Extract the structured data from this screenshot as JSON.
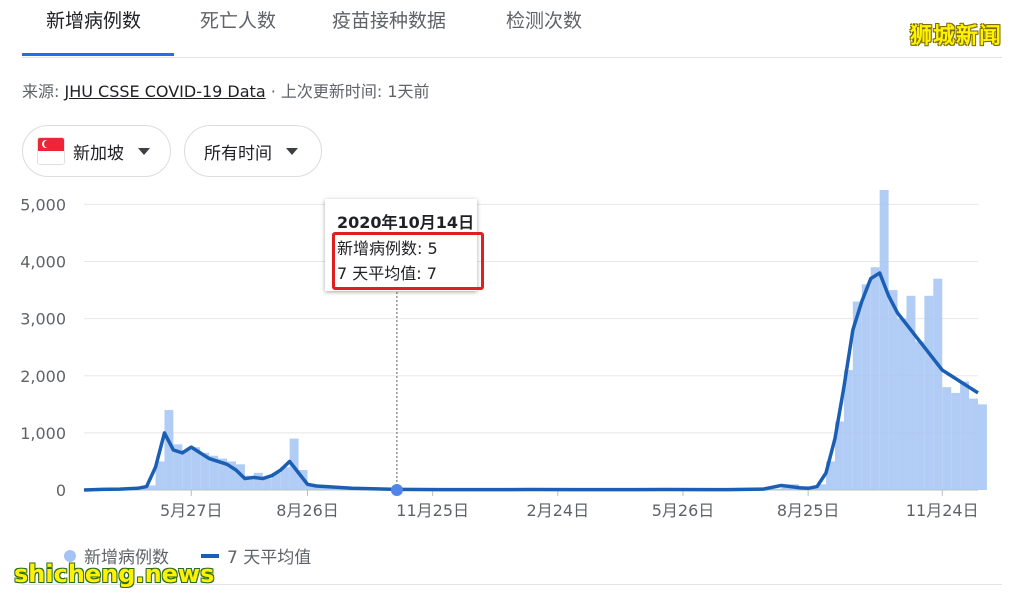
{
  "tabs": [
    {
      "label": "新增病例数",
      "active": true
    },
    {
      "label": "死亡人数",
      "active": false
    },
    {
      "label": "疫苗接种数据",
      "active": false
    },
    {
      "label": "检测次数",
      "active": false
    }
  ],
  "watermark_top": "狮城新闻",
  "source": {
    "prefix": "来源:",
    "link": "JHU CSSE COVID-19 Data",
    "suffix": "· 上次更新时间: 1天前"
  },
  "filters": {
    "country": "新加坡",
    "time_range": "所有时间"
  },
  "tooltip": {
    "date": "2020年10月14日",
    "line1": "新增病例数: 5",
    "line2": "7 天平均值: 7"
  },
  "legend": {
    "bars": "新增病例数",
    "line": "7 天平均值"
  },
  "watermark_bottom": "shicheng.news",
  "colors": {
    "bar": "#a5c4f3",
    "line": "#1a5fb4",
    "accent": "#1a73e8",
    "highlight": "#e02020"
  },
  "chart_data": {
    "type": "bar",
    "title": "",
    "xlabel": "",
    "ylabel": "",
    "ylim": [
      0,
      5000
    ],
    "yticks": [
      "0",
      "1,000",
      "2,000",
      "3,000",
      "4,000",
      "5,000"
    ],
    "xticks": [
      "5月27日",
      "8月26日",
      "11月25日",
      "2月24日",
      "5月26日",
      "8月25日",
      "11月24日"
    ],
    "tick_positions": [
      0.12,
      0.25,
      0.39,
      0.53,
      0.67,
      0.81,
      0.96
    ],
    "highlight_x": 0.35,
    "series": [
      {
        "name": "新增病例数",
        "kind": "bar",
        "x": [
          0.0,
          0.02,
          0.04,
          0.06,
          0.07,
          0.08,
          0.09,
          0.1,
          0.11,
          0.12,
          0.13,
          0.14,
          0.15,
          0.16,
          0.17,
          0.18,
          0.19,
          0.2,
          0.21,
          0.22,
          0.23,
          0.24,
          0.25,
          0.26,
          0.28,
          0.3,
          0.35,
          0.4,
          0.45,
          0.5,
          0.55,
          0.6,
          0.65,
          0.7,
          0.72,
          0.76,
          0.78,
          0.8,
          0.81,
          0.82,
          0.83,
          0.84,
          0.85,
          0.86,
          0.87,
          0.88,
          0.89,
          0.9,
          0.91,
          0.92,
          0.93,
          0.94,
          0.95,
          0.96,
          0.97,
          0.98,
          0.99,
          1.0
        ],
        "values": [
          0,
          10,
          20,
          40,
          80,
          500,
          1400,
          800,
          700,
          750,
          650,
          600,
          550,
          500,
          450,
          250,
          300,
          200,
          300,
          400,
          900,
          350,
          100,
          80,
          50,
          30,
          10,
          5,
          5,
          10,
          5,
          5,
          10,
          5,
          5,
          20,
          100,
          40,
          30,
          100,
          500,
          1200,
          2100,
          3300,
          3600,
          3900,
          5300,
          3500,
          3000,
          3400,
          2600,
          3400,
          3700,
          1800,
          1700,
          1900,
          1600,
          1500
        ]
      },
      {
        "name": "7 天平均值",
        "kind": "line",
        "x": [
          0.0,
          0.02,
          0.04,
          0.06,
          0.07,
          0.08,
          0.09,
          0.1,
          0.11,
          0.12,
          0.13,
          0.14,
          0.15,
          0.16,
          0.17,
          0.18,
          0.19,
          0.2,
          0.21,
          0.22,
          0.23,
          0.24,
          0.25,
          0.26,
          0.28,
          0.3,
          0.35,
          0.4,
          0.45,
          0.5,
          0.55,
          0.6,
          0.65,
          0.7,
          0.72,
          0.76,
          0.78,
          0.8,
          0.81,
          0.82,
          0.83,
          0.84,
          0.85,
          0.86,
          0.87,
          0.88,
          0.89,
          0.9,
          0.91,
          0.92,
          0.93,
          0.94,
          0.95,
          0.96,
          0.97,
          0.98,
          0.99,
          1.0
        ],
        "values": [
          0,
          10,
          15,
          30,
          60,
          400,
          1000,
          700,
          650,
          750,
          650,
          550,
          500,
          450,
          350,
          200,
          220,
          200,
          250,
          350,
          500,
          300,
          100,
          70,
          50,
          30,
          10,
          7,
          6,
          8,
          6,
          6,
          8,
          6,
          6,
          15,
          80,
          40,
          30,
          60,
          300,
          900,
          1800,
          2800,
          3300,
          3700,
          3800,
          3400,
          3100,
          2900,
          2700,
          2500,
          2300,
          2100,
          2000,
          1900,
          1800,
          1700
        ]
      }
    ]
  }
}
